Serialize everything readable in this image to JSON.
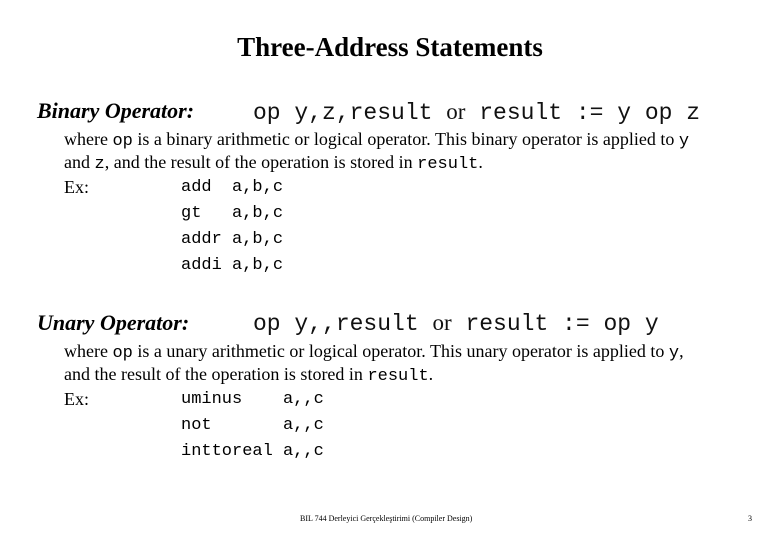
{
  "title": "Three-Address Statements",
  "binary": {
    "label": "Binary Operator:",
    "sig_part1": "op y,z,result",
    "sig_or": "or",
    "sig_part2": "result := y op z",
    "desc_line1_pre": "where ",
    "desc_line1_code": "op",
    "desc_line1_mid": " is a binary arithmetic or logical operator. This binary operator is applied to ",
    "desc_line1_code2": "y",
    "desc_line2_pre": "and ",
    "desc_line2_code": "z",
    "desc_line2_mid": ", and the result of the operation is stored in ",
    "desc_line2_code2": "result",
    "desc_line2_end": ".",
    "ex_label": "Ex:",
    "examples": [
      {
        "op": "add ",
        "args": "a,b,c"
      },
      {
        "op": "gt  ",
        "args": "a,b,c"
      },
      {
        "op": "addr",
        "args": "a,b,c"
      },
      {
        "op": "addi",
        "args": "a,b,c"
      }
    ]
  },
  "unary": {
    "label": "Unary Operator:",
    "sig_part1": "op y,,result",
    "sig_or": "or",
    "sig_part2": "result := op y",
    "desc_line1_pre": "where ",
    "desc_line1_code": "op",
    "desc_line1_mid": " is a unary arithmetic or logical operator. This unary operator is applied to ",
    "desc_line1_code2": "y",
    "desc_line1_end": ",",
    "desc_line2_pre": "and the result of the operation is stored in ",
    "desc_line2_code": "result",
    "desc_line2_end": ".",
    "ex_label": "Ex:",
    "examples": [
      {
        "op": "uminus    ",
        "args": "a,,c"
      },
      {
        "op": "not       ",
        "args": "a,,c"
      },
      {
        "op": "inttoreal ",
        "args": "a,,c"
      }
    ]
  },
  "footer": {
    "course": "BIL 744 Derleyici Gerçekleştirimi (Compiler Design)",
    "page_number": "3"
  }
}
